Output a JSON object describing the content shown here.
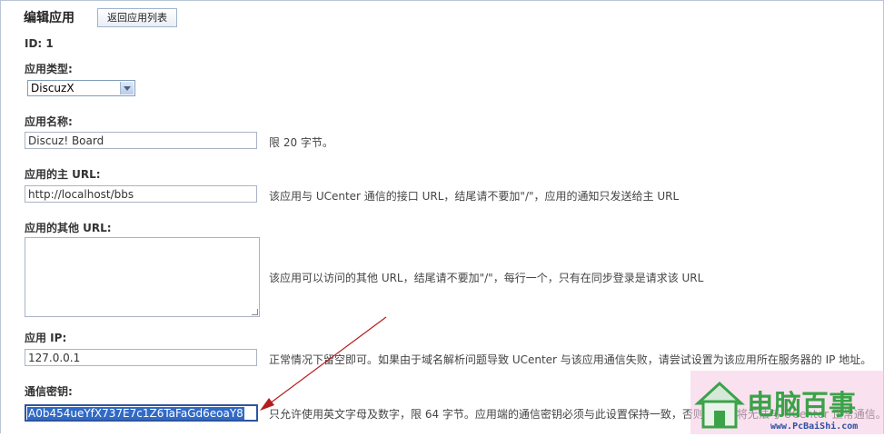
{
  "header": {
    "title": "编辑应用",
    "back_label": "返回应用列表"
  },
  "app": {
    "id_text": "ID: 1"
  },
  "fields": {
    "type": {
      "label": "应用类型:",
      "selected": "DiscuzX"
    },
    "name": {
      "label": "应用名称:",
      "value": "Discuz! Board",
      "hint": "限 20 字节。"
    },
    "main_url": {
      "label": "应用的主 URL:",
      "value": "http://localhost/bbs",
      "hint": "该应用与 UCenter 通信的接口 URL，结尾请不要加\"/\"，应用的通知只发送给主 URL"
    },
    "other_url": {
      "label": "应用的其他 URL:",
      "value": "",
      "hint": "该应用可以访问的其他 URL，结尾请不要加\"/\"，每行一个，只有在同步登录是请求该 URL"
    },
    "ip": {
      "label": "应用 IP:",
      "value": "127.0.0.1",
      "hint": "正常情况下留空即可。如果由于域名解析问题导致 UCenter 与该应用通信失败，请尝试设置为该应用所在服务器的 IP 地址。"
    },
    "secret": {
      "label": "通信密钥:",
      "value": "A0b454ueYfX737E7c1Z6TaFaGd6eoaY8",
      "hint": "只允许使用英文字母及数字，限 64 字节。应用端的通信密钥必须与此设置保持一致，否则该应用将无法与 UCenter 正常通信。"
    }
  },
  "watermark": {
    "text": "电脑百事",
    "sub": "www.PcBaiShi.com"
  },
  "colors": {
    "arrow": "#b41e1e",
    "selection": "#316ac5",
    "watermark_pink": "#f2a7cf",
    "watermark_green": "#3aa348"
  }
}
